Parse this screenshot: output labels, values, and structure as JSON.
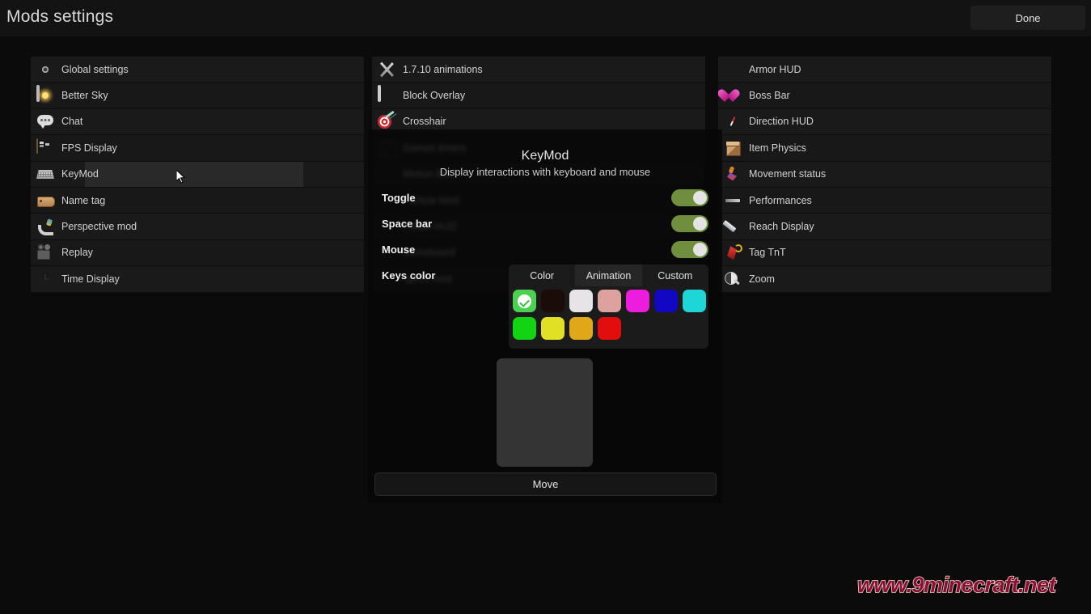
{
  "header": {
    "title": "Mods settings",
    "done_label": "Done"
  },
  "columns": {
    "left": [
      {
        "label": "Global settings",
        "icon": "gear-icon"
      },
      {
        "label": "Better Sky",
        "icon": "sky-icon"
      },
      {
        "label": "Chat",
        "icon": "chat-bubble-icon"
      },
      {
        "label": "FPS Display",
        "icon": "chest-icon"
      },
      {
        "label": "KeyMod",
        "icon": "keyboard-icon"
      },
      {
        "label": "Name tag",
        "icon": "name-tag-icon"
      },
      {
        "label": "Perspective mod",
        "icon": "perspective-icon"
      },
      {
        "label": "Replay",
        "icon": "camera-icon"
      },
      {
        "label": "Time Display",
        "icon": "clock-icon"
      }
    ],
    "middle": [
      {
        "label": "1.7.10 animations",
        "icon": "crossed-swords-icon"
      },
      {
        "label": "Block Overlay",
        "icon": "block-square-icon"
      },
      {
        "label": "Crosshair",
        "icon": "target-dart-icon"
      },
      {
        "label": "Games timers",
        "icon": "timer-icon"
      },
      {
        "label": "Motion Blur",
        "icon": "blur-cloud-icon"
      },
      {
        "label": "Particle Mod",
        "icon": "particle-icon"
      },
      {
        "label": "Potion HUD",
        "icon": "potion-icon"
      },
      {
        "label": "Scoreboard",
        "icon": "scoreboard-icon"
      },
      {
        "label": "Sprint mod",
        "icon": "sprint-icon"
      }
    ],
    "right": [
      {
        "label": "Armor HUD",
        "icon": "shield-icon"
      },
      {
        "label": "Boss Bar",
        "icon": "heart-icon"
      },
      {
        "label": "Direction HUD",
        "icon": "compass-icon"
      },
      {
        "label": "Item Physics",
        "icon": "item-box-icon"
      },
      {
        "label": "Movement status",
        "icon": "running-person-icon"
      },
      {
        "label": "Performances",
        "icon": "performance-bar-icon"
      },
      {
        "label": "Reach Display",
        "icon": "sword-blade-icon"
      },
      {
        "label": "Tag TnT",
        "icon": "tnt-icon"
      },
      {
        "label": "Zoom",
        "icon": "magnifier-icon"
      }
    ]
  },
  "selected_mod": "KeyMod",
  "overlay": {
    "title": "KeyMod",
    "description": "Display interactions with keyboard and mouse",
    "settings": [
      {
        "label": "Toggle",
        "type": "toggle",
        "value": "on"
      },
      {
        "label": "Space bar",
        "type": "toggle",
        "value": "on"
      },
      {
        "label": "Mouse",
        "type": "toggle",
        "value": "on"
      },
      {
        "label": "Keys color",
        "type": "color-picker"
      }
    ],
    "color_picker": {
      "tabs": [
        {
          "label": "Color",
          "active": true
        },
        {
          "label": "Animation",
          "active": false
        },
        {
          "label": "Custom",
          "active": false
        }
      ],
      "swatch_rows": [
        [
          {
            "name": "green-selected",
            "hex": "#4bd14f",
            "selected": true
          },
          {
            "name": "black",
            "hex": "#1c0c09",
            "selected": false
          },
          {
            "name": "white",
            "hex": "#e7e3e6",
            "selected": false
          },
          {
            "name": "pink",
            "hex": "#dda19e",
            "selected": false
          },
          {
            "name": "magenta",
            "hex": "#ec1ddc",
            "selected": false
          },
          {
            "name": "blue",
            "hex": "#1208c4",
            "selected": false
          },
          {
            "name": "cyan",
            "hex": "#1ed6d6",
            "selected": false
          }
        ],
        [
          {
            "name": "bright-green",
            "hex": "#12d412",
            "selected": false
          },
          {
            "name": "yellow",
            "hex": "#e2e025",
            "selected": false
          },
          {
            "name": "gold",
            "hex": "#e0a718",
            "selected": false
          },
          {
            "name": "red",
            "hex": "#e20d0d",
            "selected": false
          }
        ]
      ]
    },
    "move_label": "Move"
  },
  "watermark": "www.9minecraft.net"
}
